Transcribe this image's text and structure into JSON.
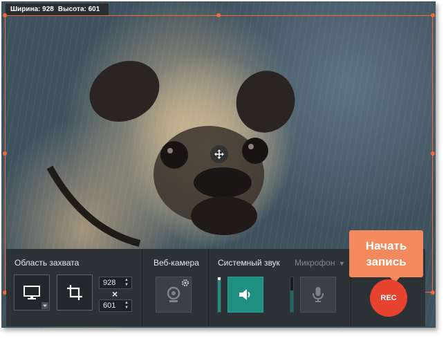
{
  "capture_size": {
    "width_label": "Ширина: 928",
    "height_label": "Высота: 601"
  },
  "capture_area": {
    "label": "Область захвата",
    "width_value": "928",
    "height_value": "601",
    "times_symbol": "×"
  },
  "webcam": {
    "label": "Веб-камера"
  },
  "system_sound": {
    "label": "Системный звук",
    "level": 0.92,
    "enabled": true
  },
  "microphone": {
    "label": "Микрофон",
    "level": 0.62,
    "enabled": false
  },
  "record": {
    "button_label": "REC",
    "tooltip_line1": "Начать",
    "tooltip_line2": "запись"
  },
  "icons": {
    "move": "move-arrows-icon",
    "fullscreen": "monitor-icon",
    "crop": "crop-icon",
    "webcam": "webcam-icon",
    "webcam_settings": "gear-icon",
    "speaker": "speaker-icon",
    "microphone": "microphone-icon"
  },
  "colors": {
    "selection": "#f26c3a",
    "panel": "#2d3237",
    "accent": "#1f8f82",
    "rec": "#e8432f",
    "tooltip": "#f3895c"
  }
}
